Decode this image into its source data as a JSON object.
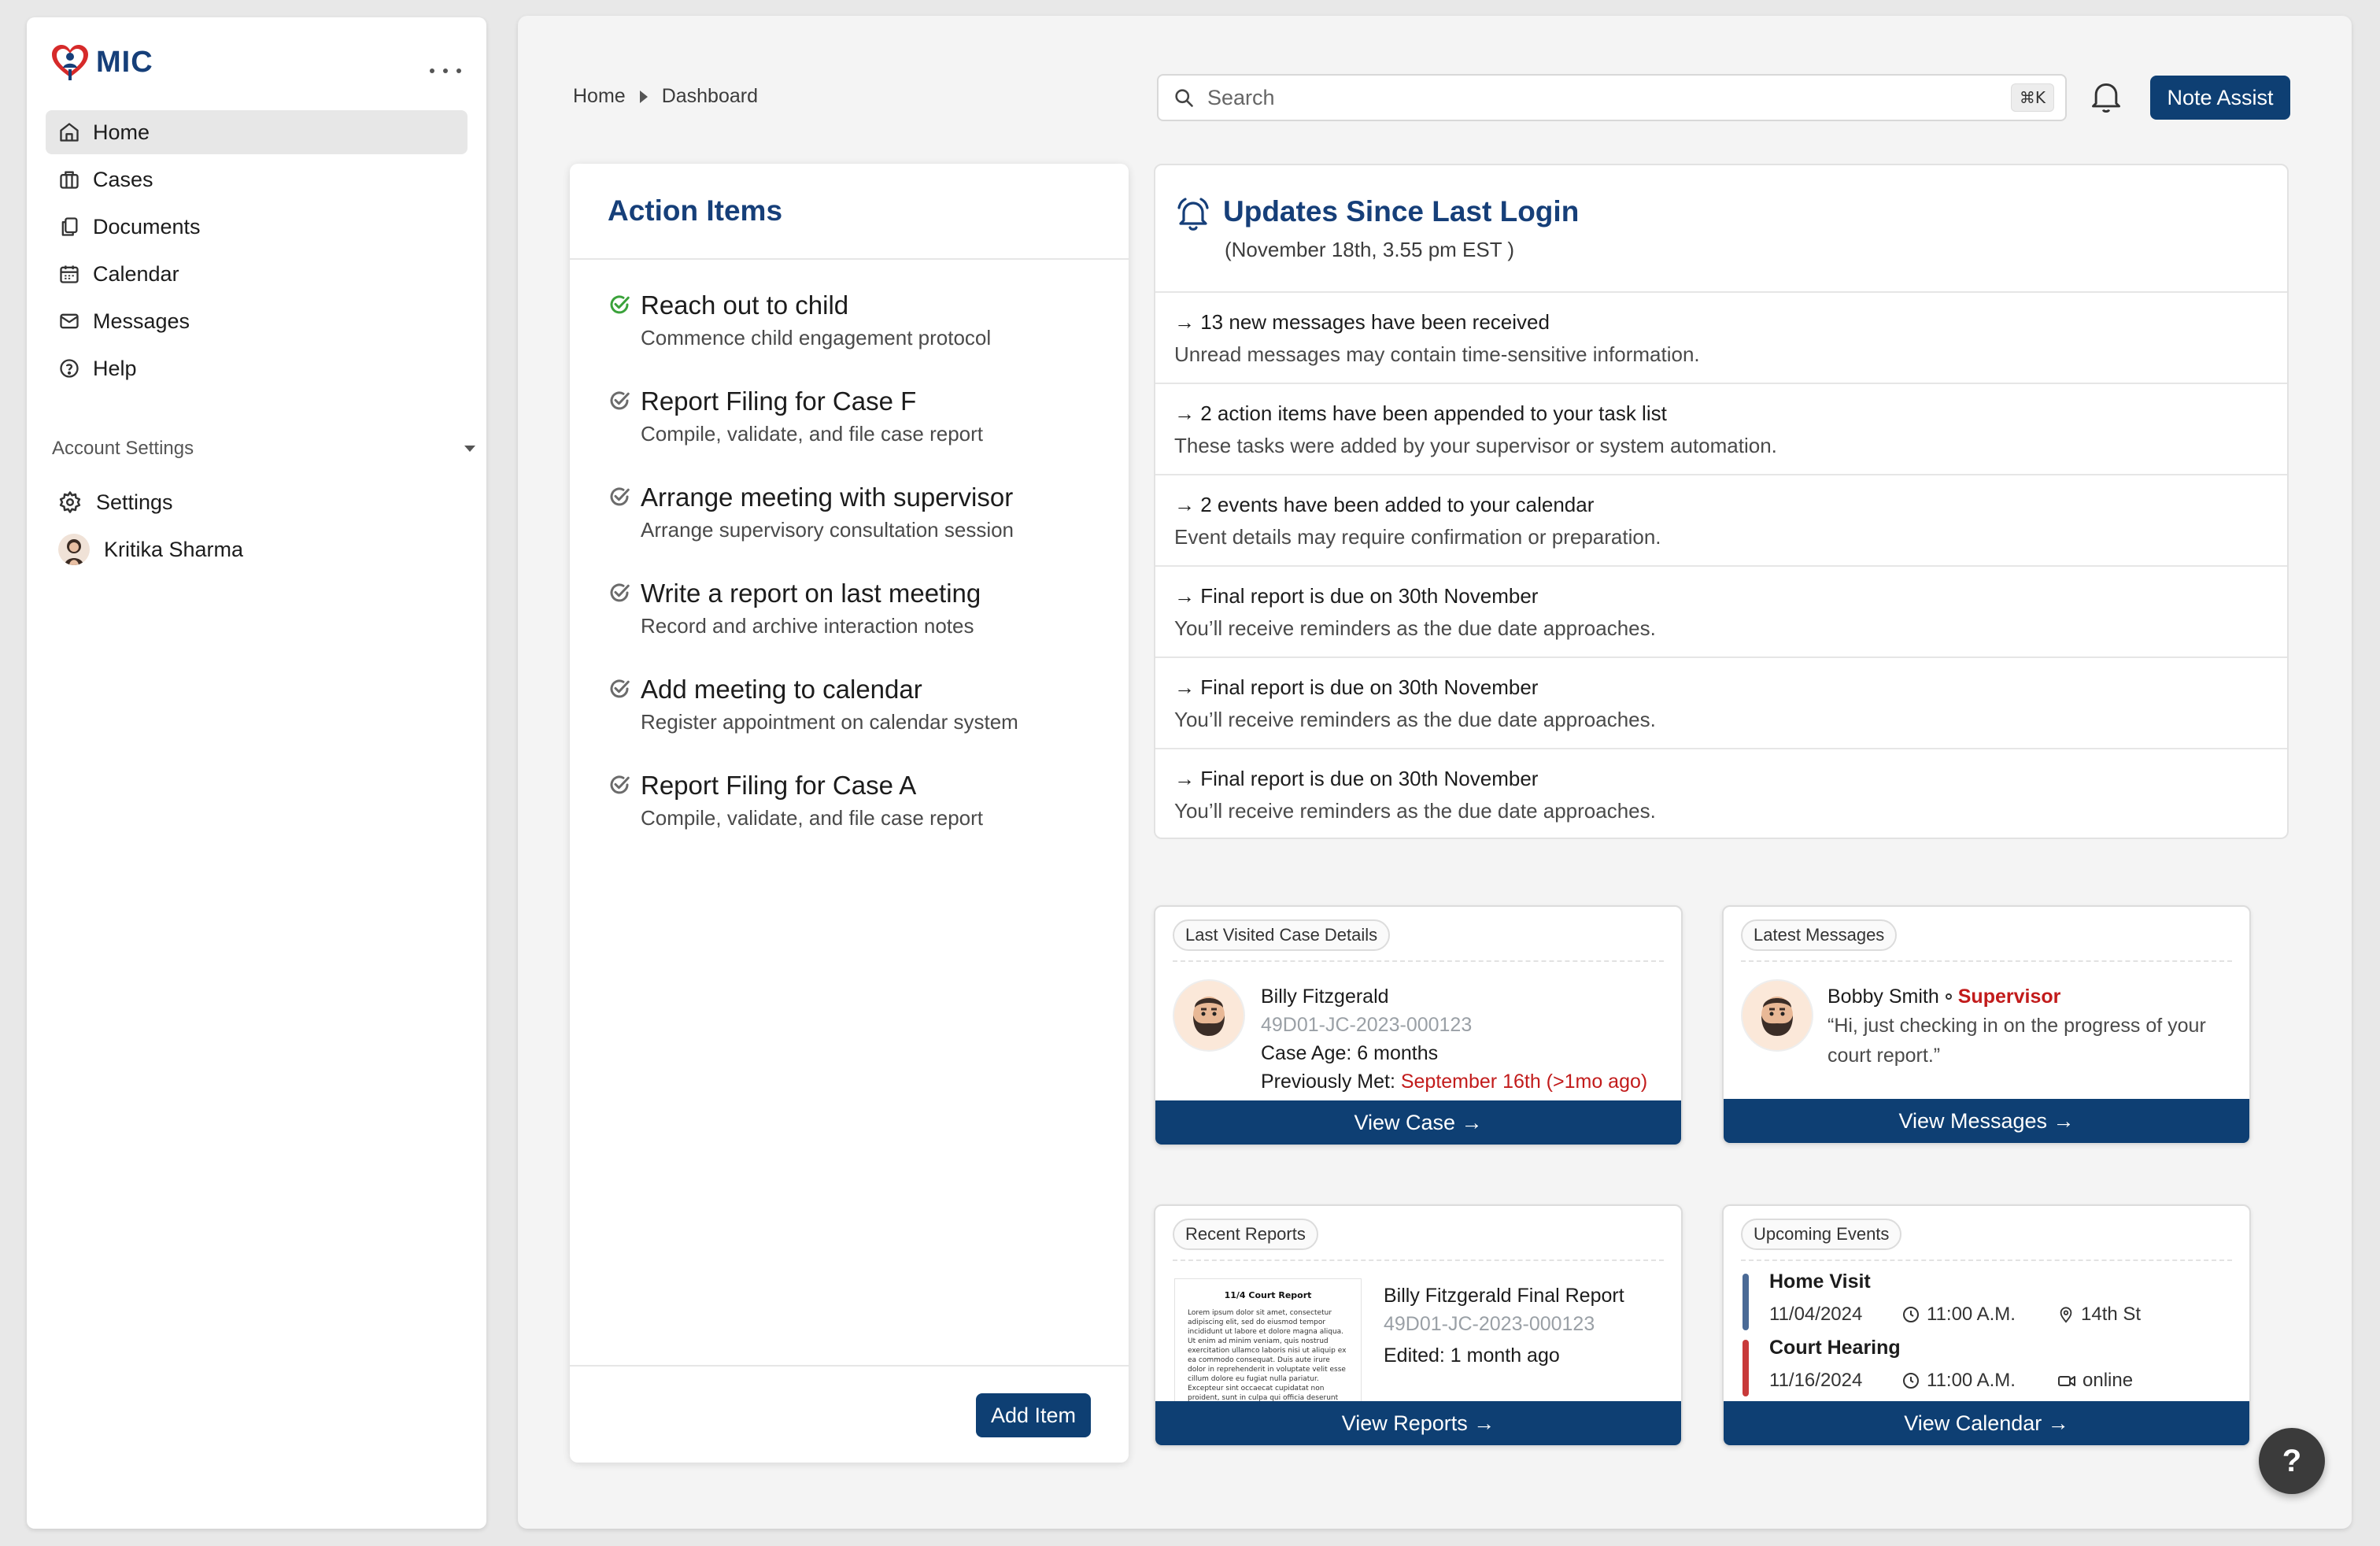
{
  "app": {
    "brand": "MIC",
    "accent": "#0e3f73",
    "title_color": "#163f79",
    "brand_heart_color": "#d62a2a"
  },
  "sidebar": {
    "nav": [
      {
        "label": "Home",
        "icon": "home-icon",
        "active": true
      },
      {
        "label": "Cases",
        "icon": "briefcase-icon"
      },
      {
        "label": "Documents",
        "icon": "documents-icon"
      },
      {
        "label": "Calendar",
        "icon": "calendar-icon"
      },
      {
        "label": "Messages",
        "icon": "mail-icon"
      },
      {
        "label": "Help",
        "icon": "help-circle-icon"
      }
    ],
    "account_section": "Account Settings",
    "settings_label": "Settings",
    "user_name": "Kritika Sharma"
  },
  "header": {
    "breadcrumb": [
      "Home",
      "Dashboard"
    ],
    "search_placeholder": "Search",
    "search_shortcut": "⌘K",
    "note_assist": "Note Assist"
  },
  "action_items": {
    "title": "Action Items",
    "items": [
      {
        "title": "Reach out to child",
        "subtitle": "Commence child engagement protocol",
        "done": true
      },
      {
        "title": "Report Filing for Case F",
        "subtitle": "Compile, validate, and file case report",
        "done": false
      },
      {
        "title": "Arrange meeting with supervisor",
        "subtitle": "Arrange supervisory consultation session",
        "done": false
      },
      {
        "title": "Write a report on last meeting",
        "subtitle": "Record and archive interaction notes",
        "done": false
      },
      {
        "title": "Add meeting to calendar",
        "subtitle": "Register appointment on calendar system",
        "done": false
      },
      {
        "title": "Report Filing for Case A",
        "subtitle": "Compile, validate, and file case report",
        "done": false
      }
    ],
    "add_button": "Add Item"
  },
  "updates": {
    "title": "Updates Since Last Login",
    "subtitle": "(November 18th, 3.55 pm EST )",
    "items": [
      {
        "title": "→ 13 new messages have been received",
        "subtitle": "Unread messages may contain time-sensitive information."
      },
      {
        "title": "→ 2 action items have been appended to your task list",
        "subtitle": "These tasks were added by your supervisor or system automation."
      },
      {
        "title": "→ 2 events have been added to your calendar",
        "subtitle": "Event details may require confirmation or preparation."
      },
      {
        "title": "→ Final report is due on 30th November",
        "subtitle": "You’ll receive reminders as the due date approaches."
      },
      {
        "title": "→ Final report is due on 30th November",
        "subtitle": "You’ll receive reminders as the due date approaches."
      },
      {
        "title": "→ Final report is due on 30th November",
        "subtitle": "You’ll receive reminders as the due date approaches."
      }
    ]
  },
  "last_case": {
    "tag": "Last Visited Case Details",
    "name": "Billy Fitzgerald",
    "case_id": "49D01-JC-2023-000123",
    "case_age": "Case Age: 6 months",
    "met_label": "Previously Met:",
    "met_value": "September 16th (>1mo ago)",
    "button": "View Case →"
  },
  "latest_messages": {
    "tag": "Latest Messages",
    "sender": "Bobby Smith",
    "role": "Supervisor",
    "quote": "“Hi, just checking in on the progress of your court report.”",
    "button": "View Messages →"
  },
  "recent_reports": {
    "tag": "Recent Reports",
    "thumb_title": "11/4 Court Report",
    "thumb_body": "Lorem ipsum dolor sit amet, consectetur adipiscing elit, sed do eiusmod tempor incididunt ut labore et dolore magna aliqua. Ut enim ad minim veniam, quis nostrud exercitation ullamco laboris nisi ut aliquip ex ea commodo consequat. Duis aute irure dolor in reprehenderit in voluptate velit esse cillum dolore eu fugiat nulla pariatur. Excepteur sint occaecat cupidatat non proident, sunt in culpa qui officia deserunt mollit anim id est laborum.",
    "title": "Billy Fitzgerald Final Report",
    "case_id": "49D01-JC-2023-000123",
    "edited": "Edited: 1 month ago",
    "button": "View Reports →"
  },
  "upcoming_events": {
    "tag": "Upcoming Events",
    "events": [
      {
        "title": "Home Visit",
        "date": "11/04/2024",
        "time": "11:00 A.M.",
        "place": "14th St",
        "place_icon": "location-pin-icon",
        "color": "#4a6a96"
      },
      {
        "title": "Court Hearing",
        "date": "11/16/2024",
        "time": "11:00 A.M.",
        "place": "online",
        "place_icon": "video-icon",
        "color": "#c83a3a"
      }
    ],
    "button": "View Calendar →"
  },
  "help_fab": "?"
}
